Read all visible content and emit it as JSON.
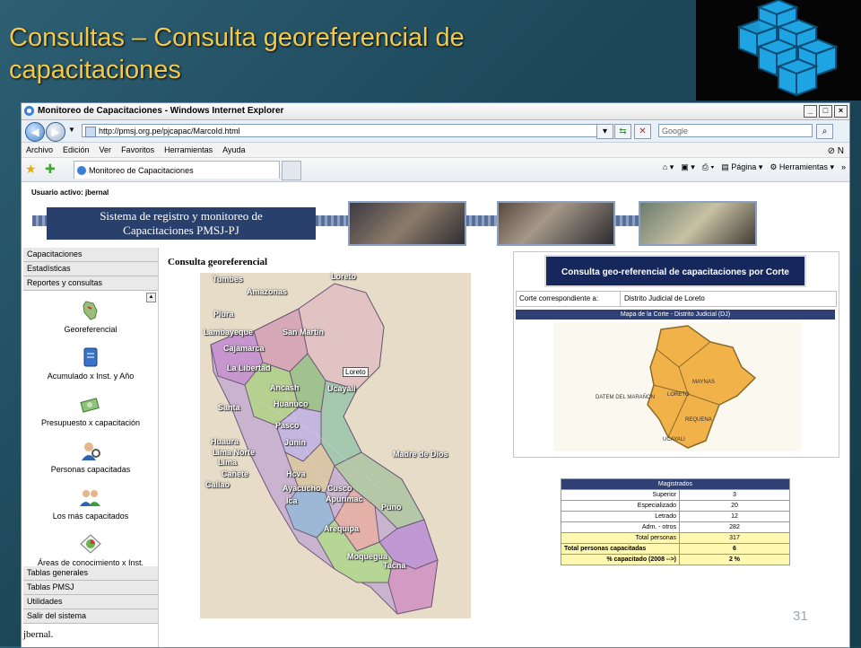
{
  "slide": {
    "title_line1": "Consultas – Consulta georeferencial de",
    "title_line2": "capacitaciones",
    "page_number": "31",
    "logo_icon": "blue-cubes-logo"
  },
  "browser": {
    "window_title": "Monitoreo de Capacitaciones - Windows Internet Explorer",
    "url": "http://pmsj.org.pe/pjcapac/MarcoId.html",
    "search_placeholder": "Google",
    "menu": [
      "Archivo",
      "Edición",
      "Ver",
      "Favoritos",
      "Herramientas",
      "Ayuda"
    ],
    "tab_title": "Monitoreo de Capacitaciones",
    "cmd_page": "Página",
    "cmd_tools": "Herramientas"
  },
  "page": {
    "user_label": "Usuario activo:",
    "user_name": "jbernal",
    "banner_line1": "Sistema de registro y monitoreo de",
    "banner_line2": "Capacitaciones PMSJ-PJ",
    "sidebar_top": [
      "Capacitaciones",
      "Estadísticas",
      "Reportes y consultas"
    ],
    "sidebar_entries": [
      {
        "label": "Georeferencial",
        "icon": "map-peru-icon"
      },
      {
        "label": "Acumulado x  Inst. y Año",
        "icon": "book-icon"
      },
      {
        "label": "Presupuesto x capacitación",
        "icon": "money-icon"
      },
      {
        "label": "Personas capacitadas",
        "icon": "person-search-icon"
      },
      {
        "label": "Los más capacitados",
        "icon": "people-icon"
      },
      {
        "label": "Áreas de conocimiento x Inst.",
        "icon": "chart-icon"
      }
    ],
    "sidebar_bottom": [
      "Tablas generales",
      "Tablas PMSJ",
      "Utilidades",
      "Salir del sistema"
    ],
    "footer_user": "jbernal.",
    "geo_title": "Consulta georeferencial",
    "map_tooltip": "Loreto",
    "regions": [
      "Tumbes",
      "Amazonas",
      "Loreto",
      "Piura",
      "Lambayeque",
      "San Martin",
      "Cajamarca",
      "La Libertad",
      "Ancash",
      "Ucayali",
      "Santa",
      "Huanuco",
      "Pasco",
      "Junin",
      "Huaura",
      "Lima Norte",
      "Lima",
      "Cañete",
      "Madre de Dios",
      "Callao",
      "Hcva",
      "Ayacucho",
      "Cusco",
      "Ica",
      "Apurimac",
      "Puno",
      "Arequipa",
      "Moquegua",
      "Tacna"
    ]
  },
  "panel": {
    "header": "Consulta geo-referencial de capacitaciones por Corte",
    "corte_label": "Corte correspondiente a:",
    "corte_value": "Distrito Judicial de Loreto",
    "map_bar": "Mapa de la Corte - Distrito Judicial (DJ)",
    "province_labels": [
      "DATEM DEL MARAÑON",
      "MAYNAS",
      "LORETO",
      "REQUENA",
      "UCAYALI"
    ]
  },
  "magistrados": {
    "header": "Magistrados",
    "rows": [
      {
        "label": "Superior",
        "value": "3"
      },
      {
        "label": "Especializado",
        "value": "20"
      },
      {
        "label": "Letrado",
        "value": "12"
      },
      {
        "label": "Adm. - otros",
        "value": "282"
      },
      {
        "label": "Total personas",
        "value": "317"
      },
      {
        "label": "Total personas capacitadas",
        "value": "6"
      },
      {
        "label": "% capacitado (2008 -->)",
        "value": "2 %"
      }
    ]
  },
  "colors": {
    "title": "#f3c94a",
    "header_blue": "#16275b",
    "bar_blue": "#2e4074",
    "map_orange": "#f2b24a"
  }
}
